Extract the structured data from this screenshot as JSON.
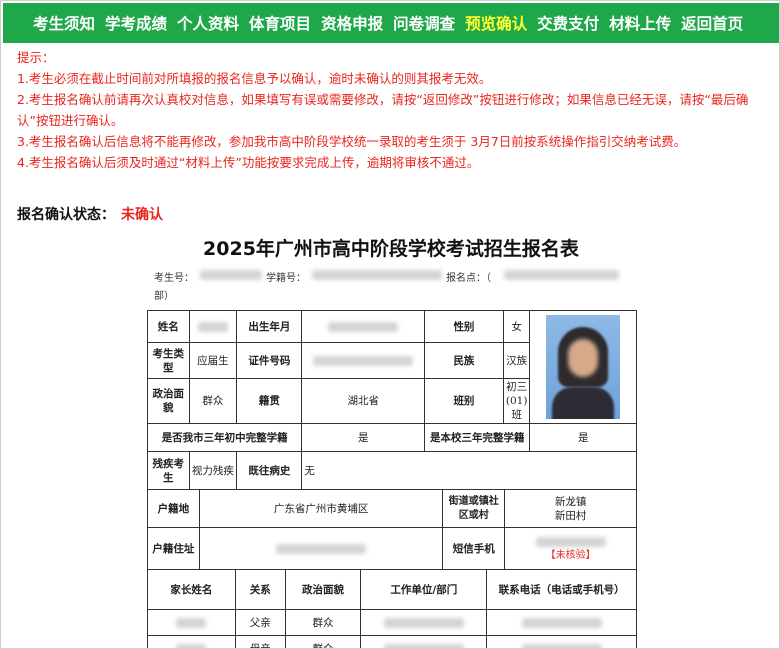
{
  "nav": {
    "items": [
      "考生须知",
      "学考成绩",
      "个人资料",
      "体育项目",
      "资格申报",
      "问卷调查",
      "预览确认",
      "交费支付",
      "材料上传",
      "返回首页"
    ],
    "active": "预览确认",
    "color": "#1fa84a",
    "active_color": "#ffff33"
  },
  "tips": {
    "heading": "提示：",
    "lines": [
      "1.考生必须在截止时间前对所填报的报名信息予以确认，逾时未确认的则其报考无效。",
      "2.考生报名确认前请再次认真校对信息，如果填写有误或需要修改，请按“返回修改”按钮进行修改；如果信息已经无误，请按“最后确认”按钮进行确认。",
      "3.考生报名确认后信息将不能再修改，参加我市高中阶段学校统一录取的考生须于 3月7日前按系统操作指引交纳考试费。",
      "4.考生报名确认后须及时通过“材料上传”功能按要求完成上传，逾期将审核不通过。"
    ],
    "color": "#e8261d"
  },
  "status": {
    "label": "报名确认状态：",
    "value": "未确认"
  },
  "form": {
    "title": "2025年广州市高中阶段学校考试招生报名表",
    "meta": {
      "exam_no_label": "考生号：",
      "school_no_label": "学籍号：",
      "site_label": "报名点：（",
      "site_tail": "部）"
    },
    "row1": {
      "name_label": "姓名",
      "birth_label": "出生年月",
      "gender_label": "性别",
      "gender_value": "女"
    },
    "row2": {
      "type_label": "考生类型",
      "type_value": "应届生",
      "id_label": "证件号码",
      "ethnic_label": "民族",
      "ethnic_value": "汉族"
    },
    "row3": {
      "politic_label": "政治面貌",
      "politic_value": "群众",
      "native_label": "籍贯",
      "native_value": "湖北省",
      "class_label": "班别",
      "class_value": "初三(01)班"
    },
    "row4": {
      "q1_label": "是否我市三年初中完整学籍",
      "q1_value": "是",
      "q2_label": "是本校三年完整学籍",
      "q2_value": "是"
    },
    "row5": {
      "disabled_label": "残疾考生",
      "disabled_value": "视力残疾",
      "history_label": "既往病史",
      "history_value": "无"
    },
    "row6": {
      "huji_label": "户籍地",
      "huji_value": "广东省广州市黄埔区",
      "street_label": "街道或镇社区或村",
      "street_value1": "新龙镇",
      "street_value2": "新田村"
    },
    "row7": {
      "addr_label": "户籍住址",
      "sms_label": "短信手机",
      "unverified": "【未核验】"
    },
    "parents": {
      "headers": [
        "家长姓名",
        "关系",
        "政治面貌",
        "工作单位/部门",
        "联系电话（电话或手机号）"
      ],
      "rows": [
        {
          "relation": "父亲",
          "politic": "群众"
        },
        {
          "relation": "母亲",
          "politic": "群众"
        }
      ]
    }
  }
}
